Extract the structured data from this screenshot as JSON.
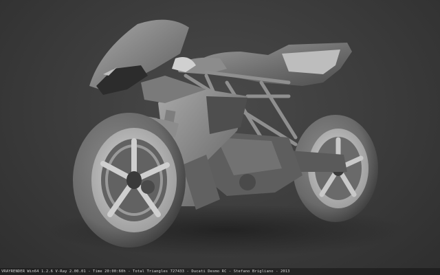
{
  "statusbar": {
    "text": "VRAYRENDER Win64 1.2.6 V-Ray 2.00.01 - Time 20:00:60h - Total Triangles 727433 - Ducati Desmo RC - Stefano Brigliano - 2013"
  },
  "colors": {
    "background": "#3a3a3a",
    "model_mid": "#6e6e6e",
    "model_light": "#bdbdbd",
    "model_dark": "#2a2a2a"
  }
}
